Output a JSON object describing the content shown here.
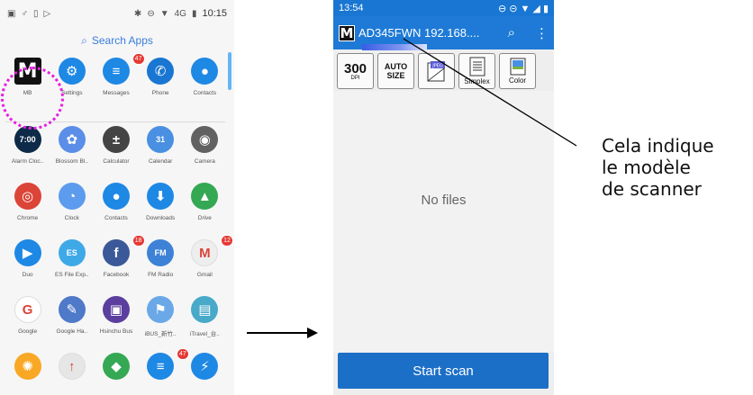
{
  "left_phone": {
    "status_time": "10:15",
    "status_signal": "4G",
    "search_label": "Search Apps",
    "apps": [
      [
        {
          "label": "MB",
          "icon": "mb-logo-icon",
          "glyph": "M",
          "color": "#111111",
          "badge": ""
        },
        {
          "label": "Settings",
          "icon": "gear-icon",
          "glyph": "⚙",
          "color": "#1e88e5",
          "badge": ""
        },
        {
          "label": "Messages",
          "icon": "messages-icon",
          "glyph": "≡",
          "color": "#1e88e5",
          "badge": "47"
        },
        {
          "label": "Phone",
          "icon": "phone-icon",
          "glyph": "✆",
          "color": "#1976d2",
          "badge": ""
        },
        {
          "label": "Contacts",
          "icon": "contacts-icon",
          "glyph": "●",
          "color": "#1e88e5",
          "badge": ""
        }
      ],
      [
        {
          "label": "Alarm Cloc..",
          "icon": "alarm-clock-icon",
          "glyph": "7:00",
          "color": "#0d2a48",
          "badge": ""
        },
        {
          "label": "Blossom Bl..",
          "icon": "blossom-blast-icon",
          "glyph": "✿",
          "color": "#5a8ee8",
          "badge": ""
        },
        {
          "label": "Calculator",
          "icon": "calculator-icon",
          "glyph": "±",
          "color": "#444444",
          "badge": ""
        },
        {
          "label": "Calendar",
          "icon": "calendar-icon",
          "glyph": "31",
          "color": "#4a90e2",
          "badge": ""
        },
        {
          "label": "Camera",
          "icon": "camera-icon",
          "glyph": "◉",
          "color": "#616161",
          "badge": ""
        }
      ],
      [
        {
          "label": "Chrome",
          "icon": "chrome-icon",
          "glyph": "◎",
          "color": "#db4437",
          "badge": ""
        },
        {
          "label": "Clock",
          "icon": "clock-icon",
          "glyph": "◔",
          "color": "#5c9bee",
          "badge": ""
        },
        {
          "label": "Contacts",
          "icon": "contacts-icon",
          "glyph": "●",
          "color": "#1e88e5",
          "badge": ""
        },
        {
          "label": "Downloads",
          "icon": "downloads-icon",
          "glyph": "⬇",
          "color": "#1e88e5",
          "badge": ""
        },
        {
          "label": "Drive",
          "icon": "drive-icon",
          "glyph": "▲",
          "color": "#34a853",
          "badge": ""
        }
      ],
      [
        {
          "label": "Duo",
          "icon": "duo-icon",
          "glyph": "▶",
          "color": "#1e88e5",
          "badge": ""
        },
        {
          "label": "ES File Exp..",
          "icon": "es-file-explorer-icon",
          "glyph": "ES",
          "color": "#3fa9e8",
          "badge": ""
        },
        {
          "label": "Facebook",
          "icon": "facebook-icon",
          "glyph": "f",
          "color": "#3b5998",
          "badge": "18"
        },
        {
          "label": "FM Radio",
          "icon": "fm-radio-icon",
          "glyph": "FM",
          "color": "#3d82d6",
          "badge": ""
        },
        {
          "label": "Gmail",
          "icon": "gmail-icon",
          "glyph": "M",
          "color": "#eeeeee",
          "badge": "12"
        }
      ],
      [
        {
          "label": "Google",
          "icon": "google-icon",
          "glyph": "G",
          "color": "#ffffff",
          "badge": ""
        },
        {
          "label": "Google Ha..",
          "icon": "google-handwriting-icon",
          "glyph": "✎",
          "color": "#4f79c9",
          "badge": ""
        },
        {
          "label": "Hsinchu Bus",
          "icon": "hsinchu-bus-icon",
          "glyph": "▣",
          "color": "#5b3e9e",
          "badge": ""
        },
        {
          "label": "iBUS_新竹..",
          "icon": "ibus-icon",
          "glyph": "⚑",
          "color": "#6aa8e8",
          "badge": ""
        },
        {
          "label": "iTravel_台..",
          "icon": "itravel-icon",
          "glyph": "▤",
          "color": "#48a9c9",
          "badge": ""
        }
      ],
      [
        {
          "label": "",
          "icon": "bulb-icon",
          "glyph": "✺",
          "color": "#f9a825",
          "badge": ""
        },
        {
          "label": "",
          "icon": "ticket-icon",
          "glyph": "↑",
          "color": "#e6e6e6",
          "badge": ""
        },
        {
          "label": "",
          "icon": "maps-icon",
          "glyph": "◆",
          "color": "#34a853",
          "badge": ""
        },
        {
          "label": "",
          "icon": "messages-icon",
          "glyph": "≡",
          "color": "#1e88e5",
          "badge": "47"
        },
        {
          "label": "",
          "icon": "messenger-icon",
          "glyph": "⚡",
          "color": "#1e88e5",
          "badge": ""
        }
      ]
    ]
  },
  "right_phone": {
    "status_time": "13:54",
    "device_name": "AD345FWN",
    "ip_address": "192.168....",
    "toolbar": {
      "dpi_value": "300",
      "dpi_unit": "DPI",
      "size_line1": "AUTO",
      "size_line2": "SIZE",
      "format": "JPEG",
      "duplex": "Simplex",
      "color_mode": "Color"
    },
    "empty_message": "No files",
    "start_button": "Start scan"
  },
  "annotation": {
    "line1": "Cela indique",
    "line2": "le modèle",
    "line3": "de scanner"
  }
}
